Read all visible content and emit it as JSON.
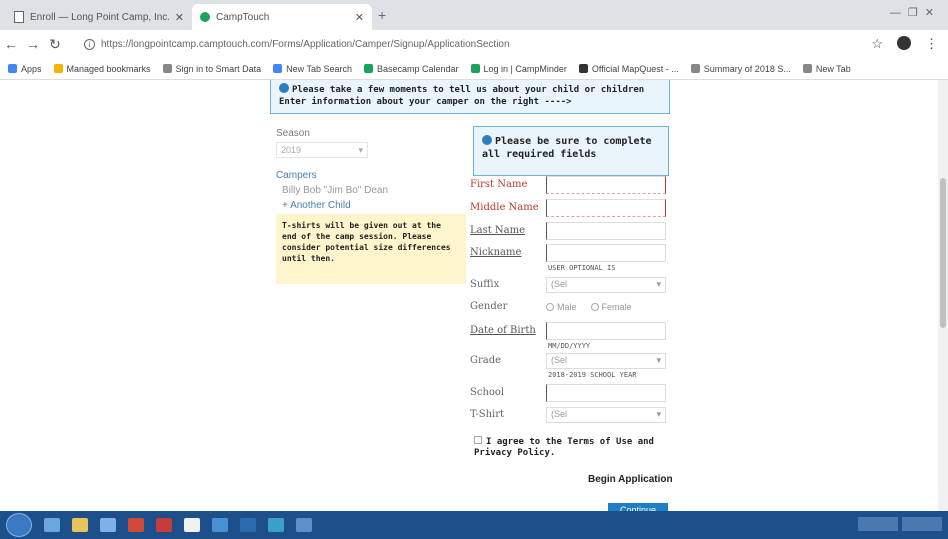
{
  "browser": {
    "tabs": [
      {
        "title": "Enroll — Long Point Camp, Inc."
      },
      {
        "title": "CampTouch"
      }
    ],
    "url": "https://longpointcamp.camptouch.com/Forms/Application/Camper/Signup/ApplicationSection",
    "bookmarks": [
      {
        "label": "Apps",
        "color": "#4285f4"
      },
      {
        "label": "Managed bookmarks",
        "color": "#f4b400"
      },
      {
        "label": "Sign in to Smart Data",
        "color": "#888888"
      },
      {
        "label": "New Tab Search",
        "color": "#4285f4"
      },
      {
        "label": "Basecamp Calendar",
        "color": "#1ea15a"
      },
      {
        "label": "Log in | CampMinder",
        "color": "#1ea15a"
      },
      {
        "label": "Official MapQuest - ...",
        "color": "#333333"
      },
      {
        "label": "Summary of 2018 S...",
        "color": "#888888"
      },
      {
        "label": "New Tab",
        "color": "#888888"
      }
    ]
  },
  "intro": {
    "line1": "Please take a few moments to tell us about your child or children",
    "line2": "Enter information about your camper on the right ---->"
  },
  "left": {
    "season_label": "Season",
    "season_value": "2019",
    "campers_label": "Campers",
    "campers": [
      {
        "name": "Billy Bob \"Jim Bo\" Dean"
      },
      {
        "name": "+ Another Child"
      }
    ],
    "tshirt_note": "T-shirts will be given out at the end of the camp session. Please consider potential size differences until then."
  },
  "required_note": "Please be sure to complete all required fields",
  "form": {
    "first_name": "First Name",
    "middle_name": "Middle Name",
    "last_name": "Last Name",
    "nickname": "Nickname",
    "nickname_hint": "USER OPTIONAL IS",
    "suffix": "Suffix",
    "suffix_value": "(Sel",
    "gender": "Gender",
    "gender_male": "Male",
    "gender_female": "Female",
    "dob": "Date of Birth",
    "dob_hint": "MM/DD/YYYY",
    "grade": "Grade",
    "grade_value": "(Sel",
    "grade_hint": "2018-2019 SCHOOL YEAR",
    "school": "School",
    "tshirt": "T-Shirt",
    "tshirt_value": "(Sel"
  },
  "terms": "I agree to the Terms of Use and Privacy Policy.",
  "begin_label": "Begin Application",
  "continue_label": "Continue",
  "colors": {
    "accent": "#1f7fc4",
    "required": "#c0392b",
    "note_bg": "#fff5cc",
    "info_bg": "#eaf5fb",
    "taskbar": "#1d4f8a"
  }
}
